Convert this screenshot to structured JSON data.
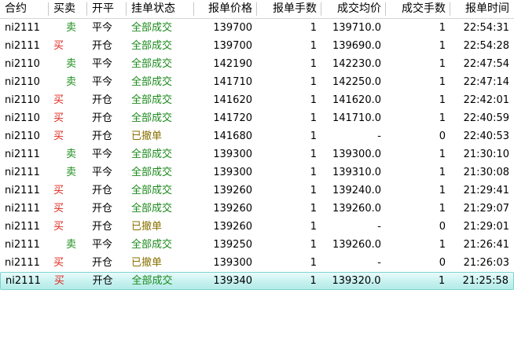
{
  "colors": {
    "buy": "#e0241b",
    "sell": "#1e8f1e",
    "filled": "#1b8a1b",
    "cancelled": "#8a7000",
    "selected_row": "#c6f1ef"
  },
  "columns": {
    "contract": "合约",
    "side": "买卖",
    "open_close": "开平",
    "status": "挂单状态",
    "order_price": "报单价格",
    "order_qty": "报单手数",
    "avg_price": "成交均价",
    "filled_qty": "成交手数",
    "order_time": "报单时间"
  },
  "rows": [
    {
      "contract": "ni2111",
      "side": "卖",
      "open_close": "平今",
      "status": "全部成交",
      "order_price": "139700",
      "order_qty": "1",
      "avg_price": "139710.0",
      "filled_qty": "1",
      "order_time": "22:54:31"
    },
    {
      "contract": "ni2111",
      "side": "买",
      "open_close": "开仓",
      "status": "全部成交",
      "order_price": "139700",
      "order_qty": "1",
      "avg_price": "139690.0",
      "filled_qty": "1",
      "order_time": "22:54:28"
    },
    {
      "contract": "ni2110",
      "side": "卖",
      "open_close": "平今",
      "status": "全部成交",
      "order_price": "142190",
      "order_qty": "1",
      "avg_price": "142230.0",
      "filled_qty": "1",
      "order_time": "22:47:54"
    },
    {
      "contract": "ni2110",
      "side": "卖",
      "open_close": "平今",
      "status": "全部成交",
      "order_price": "141710",
      "order_qty": "1",
      "avg_price": "142250.0",
      "filled_qty": "1",
      "order_time": "22:47:14"
    },
    {
      "contract": "ni2110",
      "side": "买",
      "open_close": "开仓",
      "status": "全部成交",
      "order_price": "141620",
      "order_qty": "1",
      "avg_price": "141620.0",
      "filled_qty": "1",
      "order_time": "22:42:01"
    },
    {
      "contract": "ni2110",
      "side": "买",
      "open_close": "开仓",
      "status": "全部成交",
      "order_price": "141720",
      "order_qty": "1",
      "avg_price": "141710.0",
      "filled_qty": "1",
      "order_time": "22:40:59"
    },
    {
      "contract": "ni2110",
      "side": "买",
      "open_close": "开仓",
      "status": "已撤单",
      "order_price": "141680",
      "order_qty": "1",
      "avg_price": "-",
      "filled_qty": "0",
      "order_time": "22:40:53"
    },
    {
      "contract": "ni2111",
      "side": "卖",
      "open_close": "平今",
      "status": "全部成交",
      "order_price": "139300",
      "order_qty": "1",
      "avg_price": "139300.0",
      "filled_qty": "1",
      "order_time": "21:30:10"
    },
    {
      "contract": "ni2111",
      "side": "卖",
      "open_close": "平今",
      "status": "全部成交",
      "order_price": "139300",
      "order_qty": "1",
      "avg_price": "139310.0",
      "filled_qty": "1",
      "order_time": "21:30:08"
    },
    {
      "contract": "ni2111",
      "side": "买",
      "open_close": "开仓",
      "status": "全部成交",
      "order_price": "139260",
      "order_qty": "1",
      "avg_price": "139240.0",
      "filled_qty": "1",
      "order_time": "21:29:41"
    },
    {
      "contract": "ni2111",
      "side": "买",
      "open_close": "开仓",
      "status": "全部成交",
      "order_price": "139260",
      "order_qty": "1",
      "avg_price": "139260.0",
      "filled_qty": "1",
      "order_time": "21:29:07"
    },
    {
      "contract": "ni2111",
      "side": "买",
      "open_close": "开仓",
      "status": "已撤单",
      "order_price": "139260",
      "order_qty": "1",
      "avg_price": "-",
      "filled_qty": "0",
      "order_time": "21:29:01"
    },
    {
      "contract": "ni2111",
      "side": "卖",
      "open_close": "平今",
      "status": "全部成交",
      "order_price": "139250",
      "order_qty": "1",
      "avg_price": "139260.0",
      "filled_qty": "1",
      "order_time": "21:26:41"
    },
    {
      "contract": "ni2111",
      "side": "买",
      "open_close": "开仓",
      "status": "已撤单",
      "order_price": "139300",
      "order_qty": "1",
      "avg_price": "-",
      "filled_qty": "0",
      "order_time": "21:26:03"
    },
    {
      "contract": "ni2111",
      "side": "买",
      "open_close": "开仓",
      "status": "全部成交",
      "order_price": "139340",
      "order_qty": "1",
      "avg_price": "139320.0",
      "filled_qty": "1",
      "order_time": "21:25:58",
      "selected": true
    }
  ]
}
